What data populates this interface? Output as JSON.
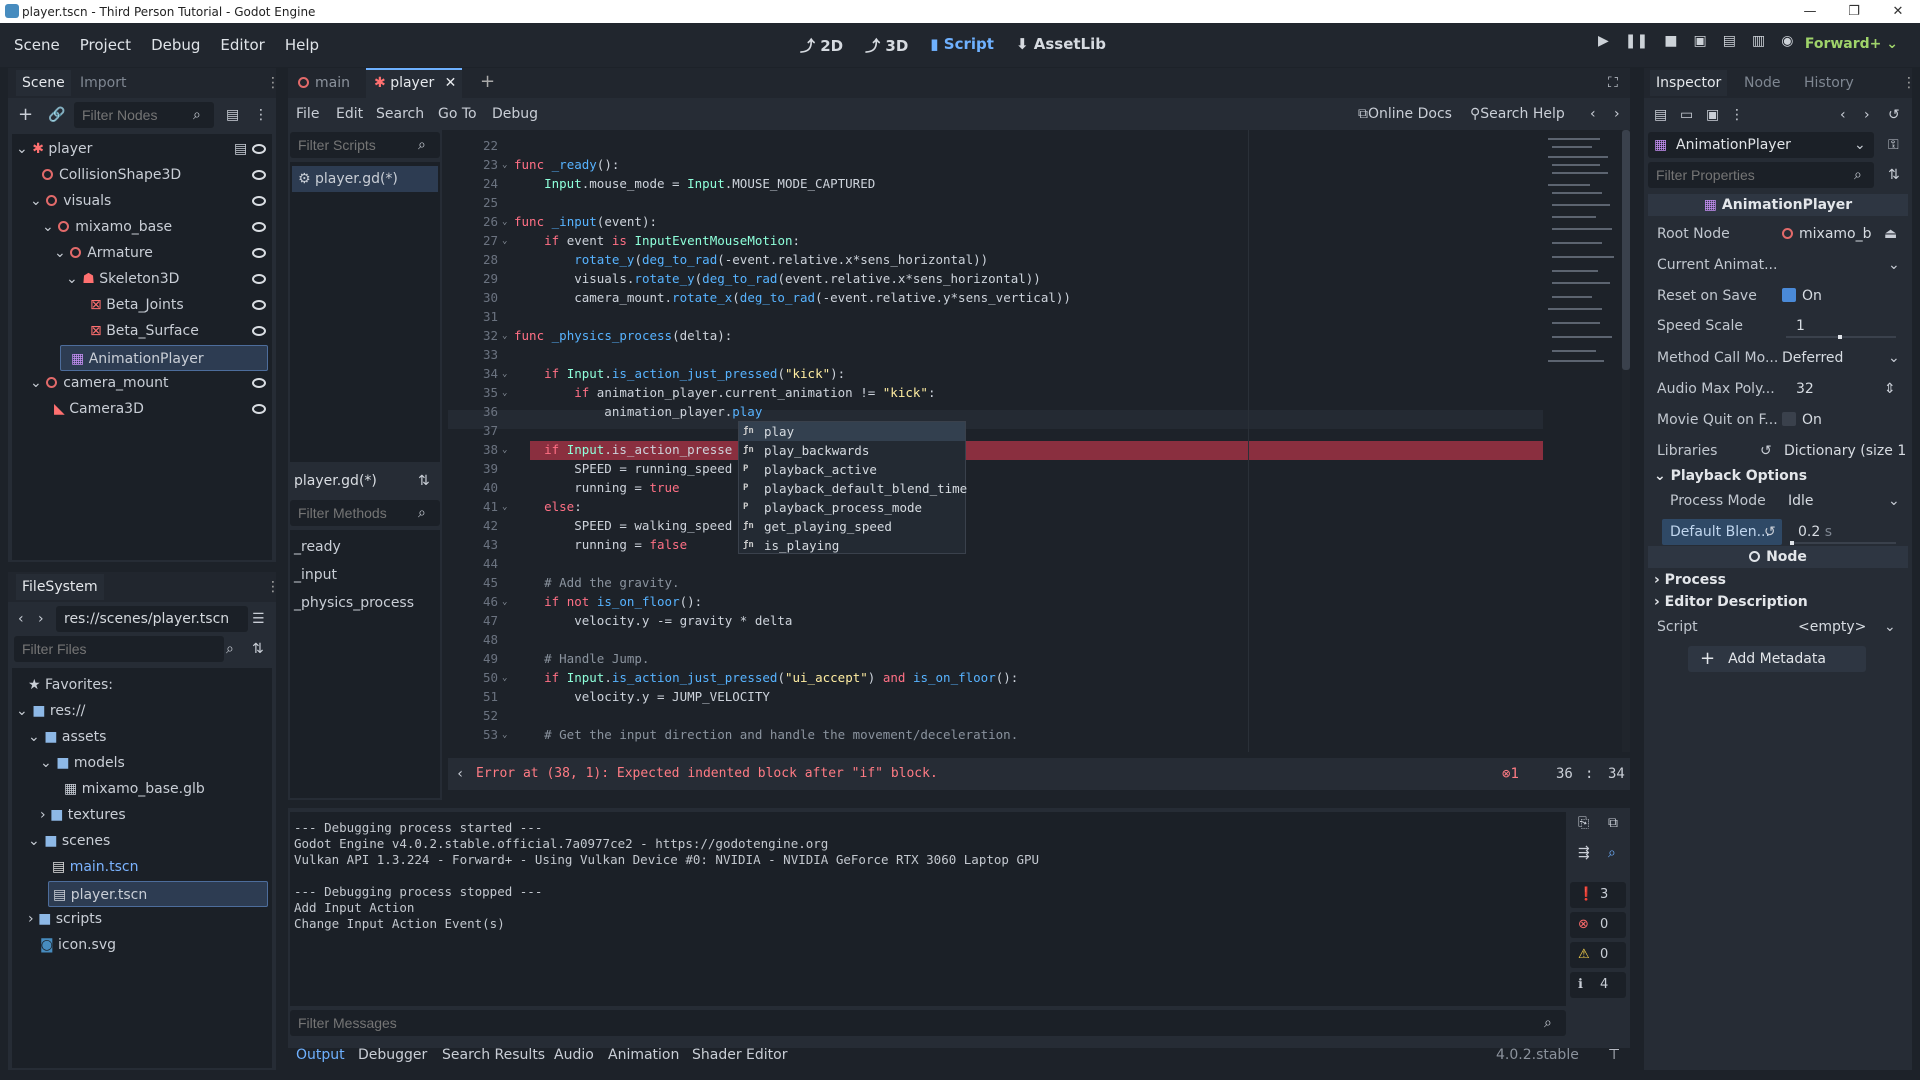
{
  "window": {
    "title": "player.tscn - Third Person Tutorial - Godot Engine",
    "controls": [
      "—",
      "❐",
      "✕"
    ]
  },
  "menu": {
    "items": [
      "Scene",
      "Project",
      "Debug",
      "Editor",
      "Help"
    ]
  },
  "main_screens": {
    "items": [
      "2D",
      "3D",
      "Script",
      "AssetLib"
    ],
    "active": "Script"
  },
  "renderer": "Forward+",
  "scene_dock": {
    "tabs": [
      "Scene",
      "Import"
    ],
    "filter_placeholder": "Filter Nodes",
    "tree": [
      {
        "label": "player",
        "depth": 0
      },
      {
        "label": "CollisionShape3D",
        "depth": 1
      },
      {
        "label": "visuals",
        "depth": 1
      },
      {
        "label": "mixamo_base",
        "depth": 2
      },
      {
        "label": "Armature",
        "depth": 3
      },
      {
        "label": "Skeleton3D",
        "depth": 4
      },
      {
        "label": "Beta_Joints",
        "depth": 5
      },
      {
        "label": "Beta_Surface",
        "depth": 5
      },
      {
        "label": "AnimationPlayer",
        "depth": 3
      },
      {
        "label": "camera_mount",
        "depth": 1
      },
      {
        "label": "Camera3D",
        "depth": 2
      }
    ]
  },
  "filesystem": {
    "title": "FileSystem",
    "path": "res://scenes/player.tscn",
    "filter_placeholder": "Filter Files",
    "favorites": "Favorites:",
    "tree": [
      {
        "label": "res://",
        "depth": 0
      },
      {
        "label": "assets",
        "depth": 1
      },
      {
        "label": "models",
        "depth": 2
      },
      {
        "label": "mixamo_base.glb",
        "depth": 3
      },
      {
        "label": "textures",
        "depth": 2
      },
      {
        "label": "scenes",
        "depth": 1
      },
      {
        "label": "main.tscn",
        "depth": 2
      },
      {
        "label": "player.tscn",
        "depth": 2
      },
      {
        "label": "scripts",
        "depth": 1
      },
      {
        "label": "icon.svg",
        "depth": 1
      }
    ]
  },
  "editor_tabs": {
    "tabs": [
      "main",
      "player"
    ],
    "active": "player"
  },
  "script_menu": {
    "items": [
      "File",
      "Edit",
      "Search",
      "Go To",
      "Debug"
    ],
    "online_docs": "Online Docs",
    "search_help": "Search Help"
  },
  "script_list": {
    "filter_placeholder": "Filter Scripts",
    "items": [
      "player.gd(*)"
    ],
    "current": "player.gd(*)",
    "methods_placeholder": "Filter Methods",
    "methods": [
      "_ready",
      "_input",
      "_physics_process"
    ]
  },
  "code_lines": [
    {
      "n": "22",
      "t": ""
    },
    {
      "n": "23",
      "t": "func _ready():"
    },
    {
      "n": "24",
      "t": "    Input.mouse_mode = Input.MOUSE_MODE_CAPTURED"
    },
    {
      "n": "25",
      "t": ""
    },
    {
      "n": "26",
      "t": "func _input(event):"
    },
    {
      "n": "27",
      "t": "    if event is InputEventMouseMotion:"
    },
    {
      "n": "28",
      "t": "        rotate_y(deg_to_rad(-event.relative.x*sens_horizontal))"
    },
    {
      "n": "29",
      "t": "        visuals.rotate_y(deg_to_rad(event.relative.x*sens_horizontal))"
    },
    {
      "n": "30",
      "t": "        camera_mount.rotate_x(deg_to_rad(-event.relative.y*sens_vertical))"
    },
    {
      "n": "31",
      "t": ""
    },
    {
      "n": "32",
      "t": "func _physics_process(delta):"
    },
    {
      "n": "33",
      "t": ""
    },
    {
      "n": "34",
      "t": "    if Input.is_action_just_pressed(\"kick\"):"
    },
    {
      "n": "35",
      "t": "        if animation_player.current_animation != \"kick\":"
    },
    {
      "n": "36",
      "t": "            animation_player.play"
    },
    {
      "n": "37",
      "t": ""
    },
    {
      "n": "38",
      "t": "    if Input.is_action_presse"
    },
    {
      "n": "39",
      "t": "        SPEED = running_speed"
    },
    {
      "n": "40",
      "t": "        running = true"
    },
    {
      "n": "41",
      "t": "    else:"
    },
    {
      "n": "42",
      "t": "        SPEED = walking_speed"
    },
    {
      "n": "43",
      "t": "        running = false"
    },
    {
      "n": "44",
      "t": ""
    },
    {
      "n": "45",
      "t": "    # Add the gravity."
    },
    {
      "n": "46",
      "t": "    if not is_on_floor():"
    },
    {
      "n": "47",
      "t": "        velocity.y -= gravity * delta"
    },
    {
      "n": "48",
      "t": ""
    },
    {
      "n": "49",
      "t": "    # Handle Jump."
    },
    {
      "n": "50",
      "t": "    if Input.is_action_just_pressed(\"ui_accept\") and is_on_floor():"
    },
    {
      "n": "51",
      "t": "        velocity.y = JUMP_VELOCITY"
    },
    {
      "n": "52",
      "t": ""
    },
    {
      "n": "53",
      "t": "    # Get the input direction and handle the movement/deceleration."
    }
  ],
  "autocomplete": [
    {
      "kind": "ƒn",
      "label": "play"
    },
    {
      "kind": "ƒn",
      "label": "play_backwards"
    },
    {
      "kind": "P",
      "label": "playback_active"
    },
    {
      "kind": "P",
      "label": "playback_default_blend_time"
    },
    {
      "kind": "P",
      "label": "playback_process_mode"
    },
    {
      "kind": "ƒn",
      "label": "get_playing_speed"
    },
    {
      "kind": "ƒn",
      "label": "is_playing"
    }
  ],
  "status": {
    "error": "Error at (38, 1): Expected indented block after \"if\" block.",
    "error_count": "1",
    "line": "36",
    "sep": ":",
    "col": "34"
  },
  "output": {
    "lines": [
      "--- Debugging process started ---",
      "Godot Engine v4.0.2.stable.official.7a0977ce2 - https://godotengine.org",
      "Vulkan API 1.3.224 - Forward+ - Using Vulkan Device #0: NVIDIA - NVIDIA GeForce RTX 3060 Laptop GPU",
      "",
      "--- Debugging process stopped ---",
      "Add Input Action",
      "Change Input Action Event(s)"
    ],
    "filter_placeholder": "Filter Messages",
    "counts": {
      "messages": "3",
      "errors": "0",
      "warnings": "0",
      "info": "4"
    }
  },
  "bottom_tabs": {
    "tabs": [
      "Output",
      "Debugger",
      "Search Results",
      "Audio",
      "Animation",
      "Shader Editor"
    ],
    "version": "4.0.2.stable"
  },
  "inspector": {
    "tabs": [
      "Inspector",
      "Node",
      "History"
    ],
    "object": "AnimationPlayer",
    "filter_placeholder": "Filter Properties",
    "class_header": "AnimationPlayer",
    "props": {
      "root_node_label": "Root Node",
      "root_node_value": "mixamo_b",
      "current_anim_label": "Current Animat...",
      "reset_label": "Reset on Save",
      "reset_value": "On",
      "speed_label": "Speed Scale",
      "speed_value": "1",
      "method_label": "Method Call Mo...",
      "method_value": "Deferred",
      "audio_label": "Audio Max Poly...",
      "audio_value": "32",
      "movie_label": "Movie Quit on F...",
      "movie_value": "On",
      "libraries_label": "Libraries",
      "libraries_value": "Dictionary (size 1",
      "playback_section": "Playback Options",
      "process_label": "Process Mode",
      "process_value": "Idle",
      "blend_label": "Default Blen...",
      "blend_value": "0.2",
      "blend_unit": "s",
      "node_header": "Node",
      "process_section": "Process",
      "editor_desc_section": "Editor Description",
      "script_label": "Script",
      "script_value": "<empty>",
      "add_metadata": "Add Metadata"
    }
  }
}
